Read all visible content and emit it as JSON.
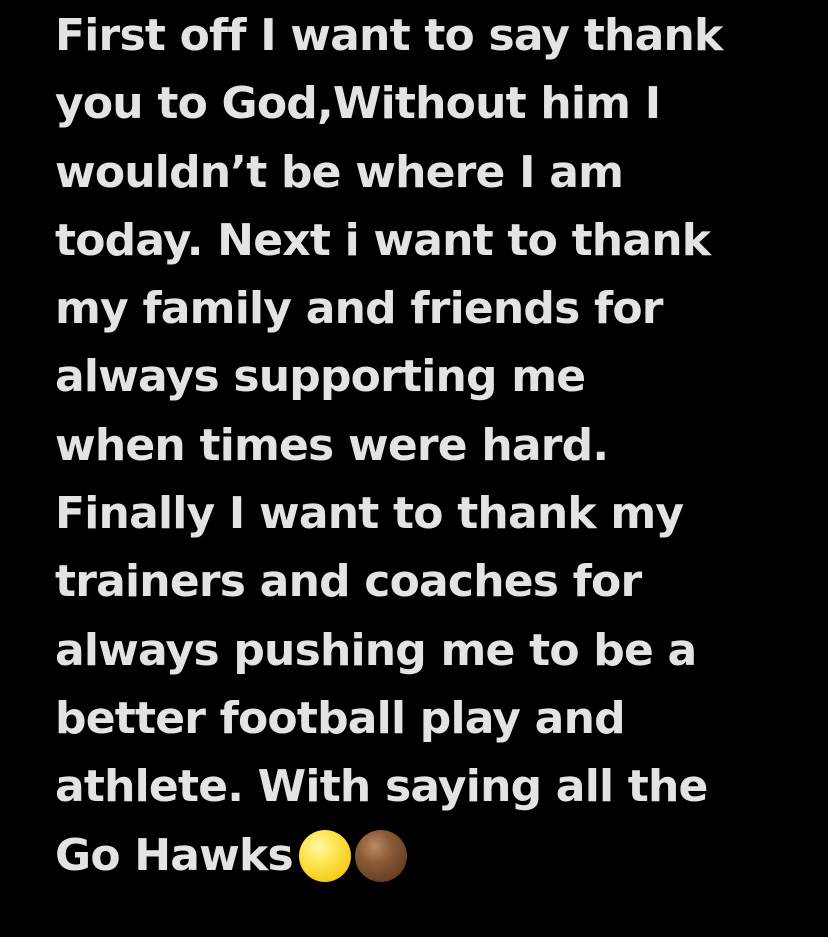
{
  "note": {
    "lines": [
      "First off I want to say thank",
      "you to God,Without him I",
      "wouldn’t be where I am",
      "today. Next i want to thank",
      "my family and friends for",
      "always supporting me",
      "when times were hard.",
      "Finally I want to thank my",
      "trainers and coaches for",
      "always pushing me to be a",
      "better football play and",
      "athlete. With saying all the",
      "Go Hawks"
    ],
    "emojis": [
      "yellow-circle-icon",
      "brown-circle-icon"
    ]
  },
  "colors": {
    "background": "#000000",
    "text": "#e3e3e3",
    "emoji_yellow": "#f7cf1e",
    "emoji_brown": "#6b4226"
  }
}
